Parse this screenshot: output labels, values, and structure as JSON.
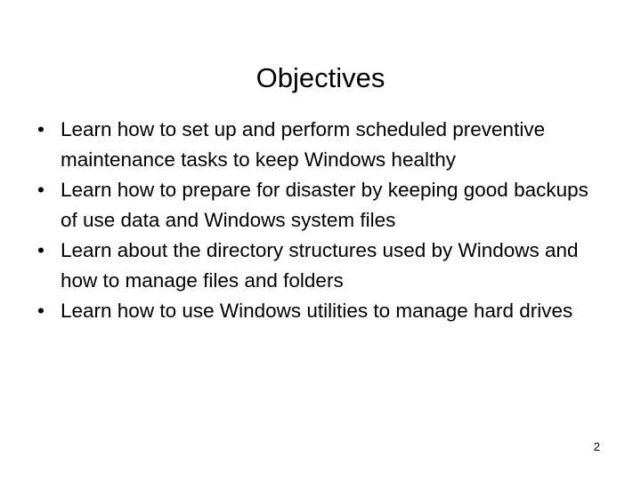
{
  "slide": {
    "title": "Objectives",
    "page_number": "2",
    "background_color": "#ffffff",
    "text_color": "#000000",
    "bullet_glyph": "•",
    "bullets": [
      {
        "text": "Learn how to set up and perform scheduled preventive maintenance tasks to keep Windows healthy"
      },
      {
        "text": "Learn how to prepare for disaster by keeping good backups of use data and Windows system files"
      },
      {
        "text": "Learn about the directory structures used by Windows and how to manage files and folders"
      },
      {
        "text": "Learn how to use Windows utilities to manage hard drives"
      }
    ]
  }
}
